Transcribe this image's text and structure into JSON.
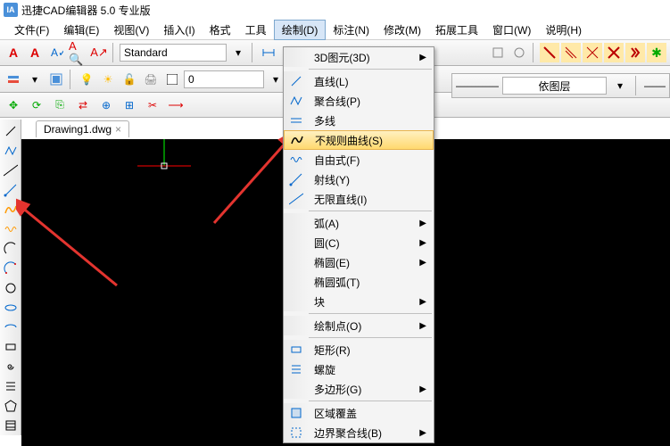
{
  "title": "迅捷CAD编辑器 5.0 专业版",
  "app_icon": "IA",
  "menubar": {
    "file": "文件(F)",
    "edit": "编辑(E)",
    "view": "视图(V)",
    "insert": "插入(I)",
    "format": "格式",
    "tool": "工具",
    "draw": "绘制(D)",
    "annotate": "标注(N)",
    "modify": "修改(M)",
    "extend": "拓展工具",
    "window": "窗口(W)",
    "help": "说明(H)"
  },
  "toolbar": {
    "standard_style": "Standard",
    "layer_value": "0",
    "layer_combo": "依图层"
  },
  "tab": {
    "name": "Drawing1.dwg",
    "close": "×"
  },
  "draw_menu": {
    "view3d": "3D图元(3D)",
    "line": "直线(L)",
    "polyline": "聚合线(P)",
    "multiline": "多线",
    "spline": "不规则曲线(S)",
    "freehand": "自由式(F)",
    "ray": "射线(Y)",
    "xline": "无限直线(I)",
    "arc": "弧(A)",
    "circle": "圆(C)",
    "ellipse": "椭圆(E)",
    "elliparc": "椭圆弧(T)",
    "block": "块",
    "point": "绘制点(O)",
    "rect": "矩形(R)",
    "spiral": "螺旋",
    "polygon": "多边形(G)",
    "region": "区域覆盖",
    "boundary": "边界聚合线(B)"
  }
}
